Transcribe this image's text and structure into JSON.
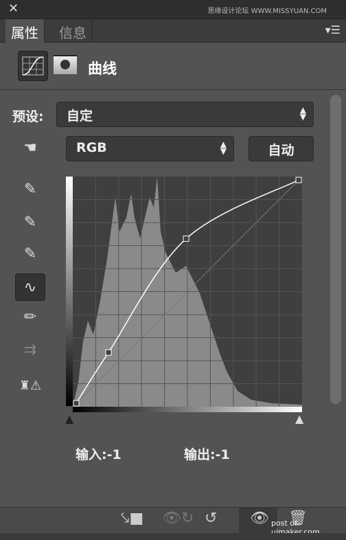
{
  "window": {
    "close_icon": "close-icon",
    "watermark": "思缘设计论坛 WWW.MISSYUAN.COM"
  },
  "tabs": [
    {
      "label": "属性",
      "active": true
    },
    {
      "label": "信息",
      "active": false
    }
  ],
  "header": {
    "title": "曲线",
    "adjustment_icon": "curves-icon",
    "mask_icon": "mask-icon"
  },
  "preset": {
    "label": "预设:",
    "value": "自定"
  },
  "channel": {
    "value": "RGB",
    "auto_label": "自动"
  },
  "tools": [
    "on-image-adjust-icon",
    "black-eyedropper-icon",
    "gray-eyedropper-icon",
    "white-eyedropper-icon",
    "curve-point-icon",
    "pencil-icon",
    "smooth-icon",
    "clipping-warning-icon"
  ],
  "curve": {
    "points": [
      [
        0,
        0
      ],
      [
        37,
        58
      ],
      [
        126,
        188
      ],
      [
        255,
        255
      ]
    ]
  },
  "readout": {
    "input_label": "输入:",
    "input_value": "-1",
    "output_label": "输出:",
    "output_value": "-1"
  },
  "footer": {
    "watermark": "post of uimaker.com"
  }
}
